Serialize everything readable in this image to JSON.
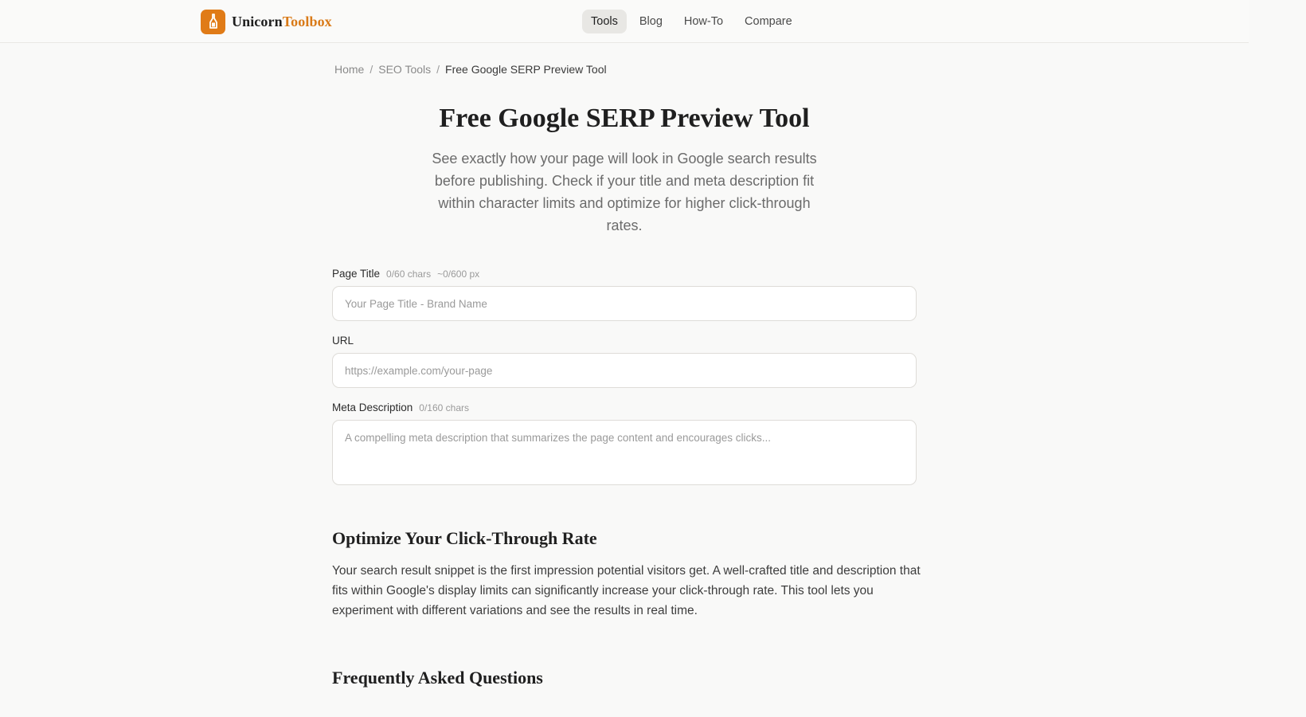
{
  "brand": {
    "name_part1": "Unicorn",
    "name_part2": "Toolbox",
    "icon": "bottle-icon",
    "accent_color": "#e07b17"
  },
  "nav": {
    "items": [
      {
        "label": "Tools",
        "active": true
      },
      {
        "label": "Blog",
        "active": false
      },
      {
        "label": "How-To",
        "active": false
      },
      {
        "label": "Compare",
        "active": false
      }
    ]
  },
  "breadcrumb": {
    "items": [
      "Home",
      "SEO Tools",
      "Free Google SERP Preview Tool"
    ],
    "separator": "/"
  },
  "hero": {
    "title": "Free Google SERP Preview Tool",
    "subtitle": "See exactly how your page will look in Google search results before publishing. Check if your title and meta description fit within character limits and optimize for higher click-through rates."
  },
  "form": {
    "title_field": {
      "label": "Page Title",
      "char_count": "0/60 chars",
      "px_count": "~0/600 px",
      "placeholder": "Your Page Title - Brand Name",
      "value": ""
    },
    "url_field": {
      "label": "URL",
      "placeholder": "https://example.com/your-page",
      "value": ""
    },
    "description_field": {
      "label": "Meta Description",
      "char_count": "0/160 chars",
      "placeholder": "A compelling meta description that summarizes the page content and encourages clicks...",
      "value": ""
    }
  },
  "content": {
    "section_title": "Optimize Your Click-Through Rate",
    "section_body": "Your search result snippet is the first impression potential visitors get. A well-crafted title and description that fits within Google's display limits can significantly increase your click-through rate. This tool lets you experiment with different variations and see the results in real time.",
    "faq_title": "Frequently Asked Questions"
  }
}
